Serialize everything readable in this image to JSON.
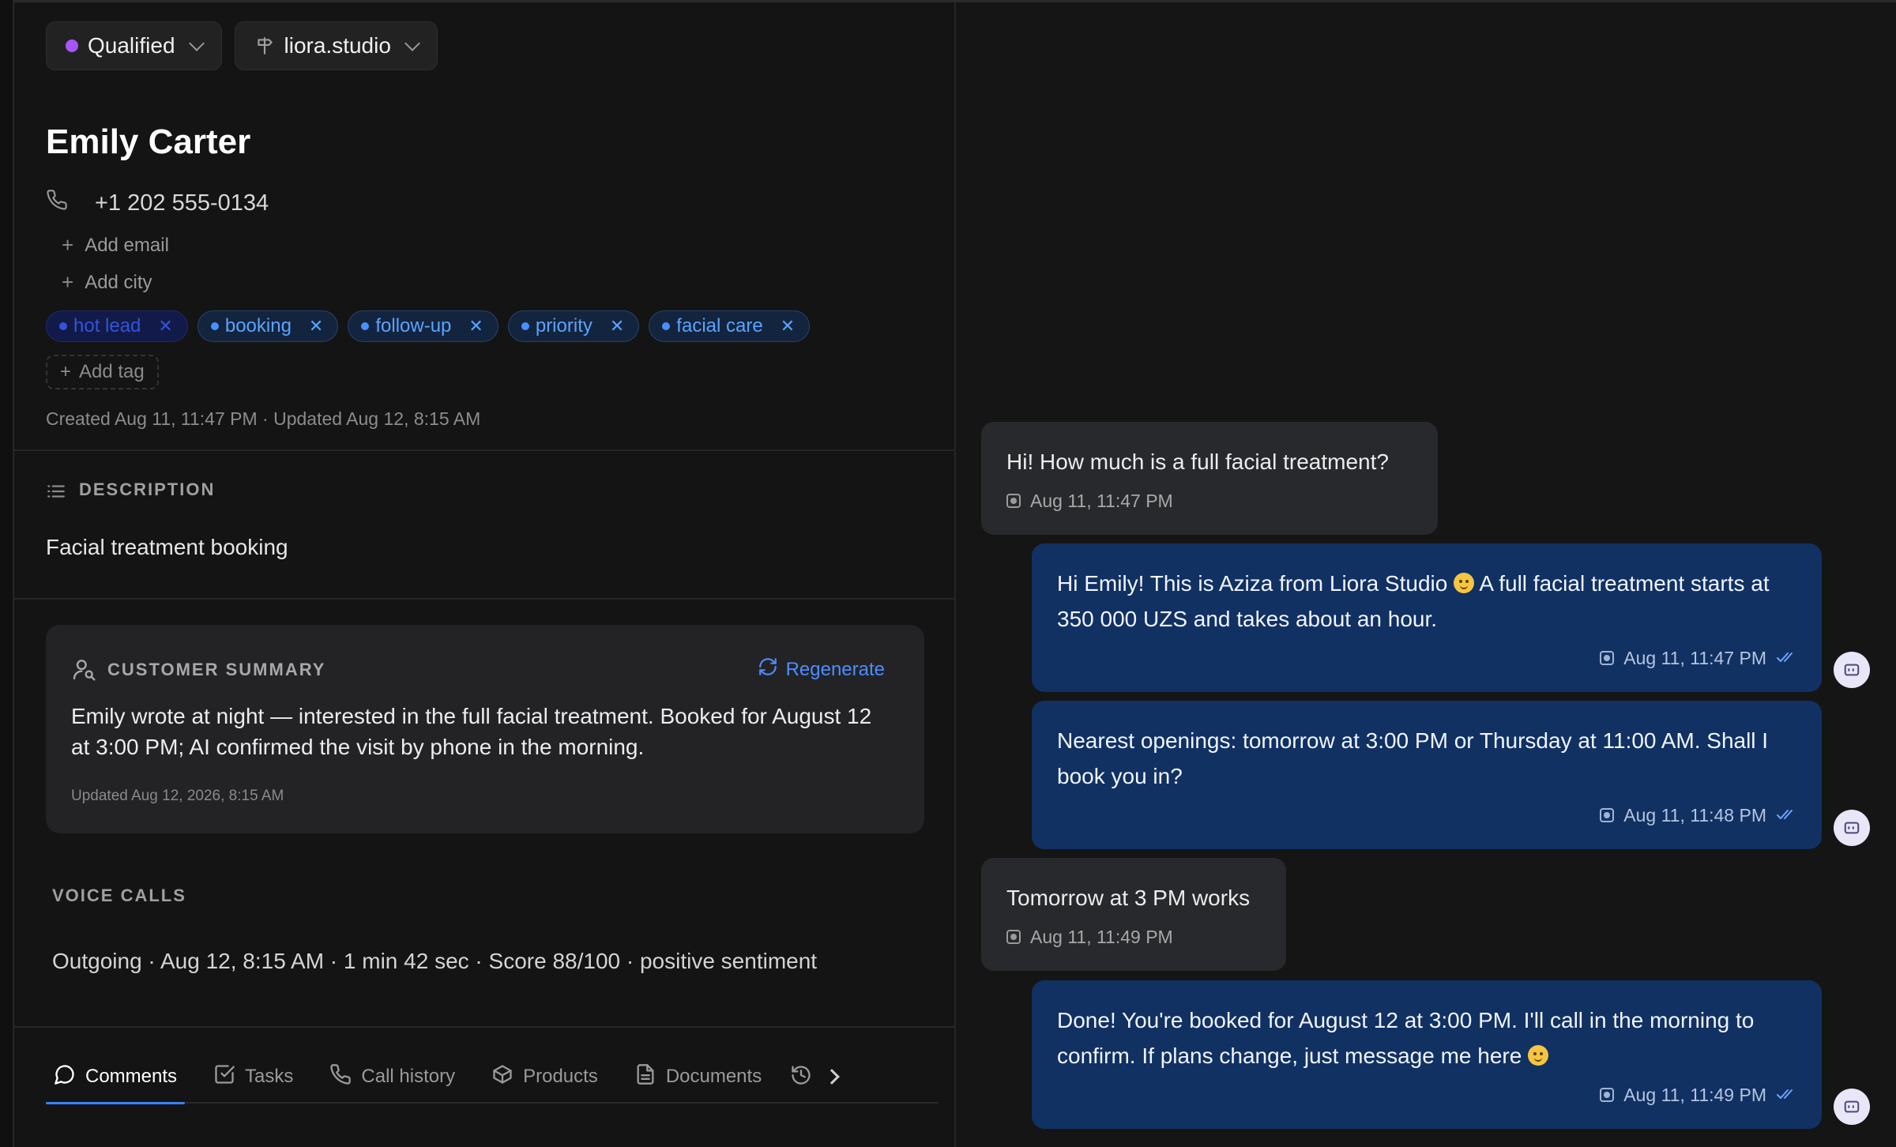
{
  "header": {
    "status": {
      "label": "Qualified",
      "color": "#a855f7"
    },
    "workspace": {
      "label": "liora.studio"
    }
  },
  "contact": {
    "name": "Emily Carter",
    "phone": "+1 202 555-0134",
    "add_email": "Add email",
    "add_city": "Add city",
    "tags": [
      {
        "label": "hot lead"
      },
      {
        "label": "booking"
      },
      {
        "label": "follow-up"
      },
      {
        "label": "priority"
      },
      {
        "label": "facial care"
      }
    ],
    "add_tag": "Add tag",
    "meta": "Created Aug 11, 11:47 PM · Updated Aug 12, 8:15 AM"
  },
  "description": {
    "label": "DESCRIPTION",
    "text": "Facial treatment booking"
  },
  "summary": {
    "label": "CUSTOMER SUMMARY",
    "regenerate": "Regenerate",
    "text": "Emily wrote at night — interested in the full facial treatment. Booked for August 12 at 3:00 PM; AI confirmed the visit by phone in the morning.",
    "updated": "Updated Aug 12, 2026, 8:15 AM"
  },
  "voice_calls": {
    "label": "VOICE CALLS",
    "entry": "Outgoing · Aug 12, 8:15 AM · 1 min 42 sec · Score 88/100 · positive sentiment"
  },
  "tabs": [
    {
      "label": "Comments",
      "icon": "chat-bubble-icon"
    },
    {
      "label": "Tasks",
      "icon": "checkbox-icon"
    },
    {
      "label": "Call history",
      "icon": "phone-icon"
    },
    {
      "label": "Products",
      "icon": "box-icon"
    },
    {
      "label": "Documents",
      "icon": "document-icon"
    }
  ],
  "messages": [
    {
      "direction": "in",
      "text": "Hi! How much is a full facial treatment?",
      "time": "Aug 11, 11:47 PM"
    },
    {
      "direction": "out",
      "text_a": "Hi Emily! This is Aziza from Liora Studio",
      "text_b": "A full facial treatment starts at 350 000 UZS and takes about an hour.",
      "time": "Aug 11, 11:47 PM"
    },
    {
      "direction": "out",
      "text": "Nearest openings: tomorrow at 3:00 PM or Thursday at 11:00 AM. Shall I book you in?",
      "time": "Aug 11, 11:48 PM"
    },
    {
      "direction": "in",
      "text": "Tomorrow at 3 PM works",
      "time": "Aug 11, 11:49 PM"
    },
    {
      "direction": "out",
      "text": "Done! You're booked for August 12 at 3:00 PM. I'll call in the morning to confirm. If plans change, just message me here",
      "time": "Aug 11, 11:49 PM"
    }
  ],
  "colors": {
    "accent": "#3b82f6",
    "outgoing_bubble": "#113163",
    "incoming_bubble": "#28292c",
    "tag_text": "#5aa3ff"
  }
}
